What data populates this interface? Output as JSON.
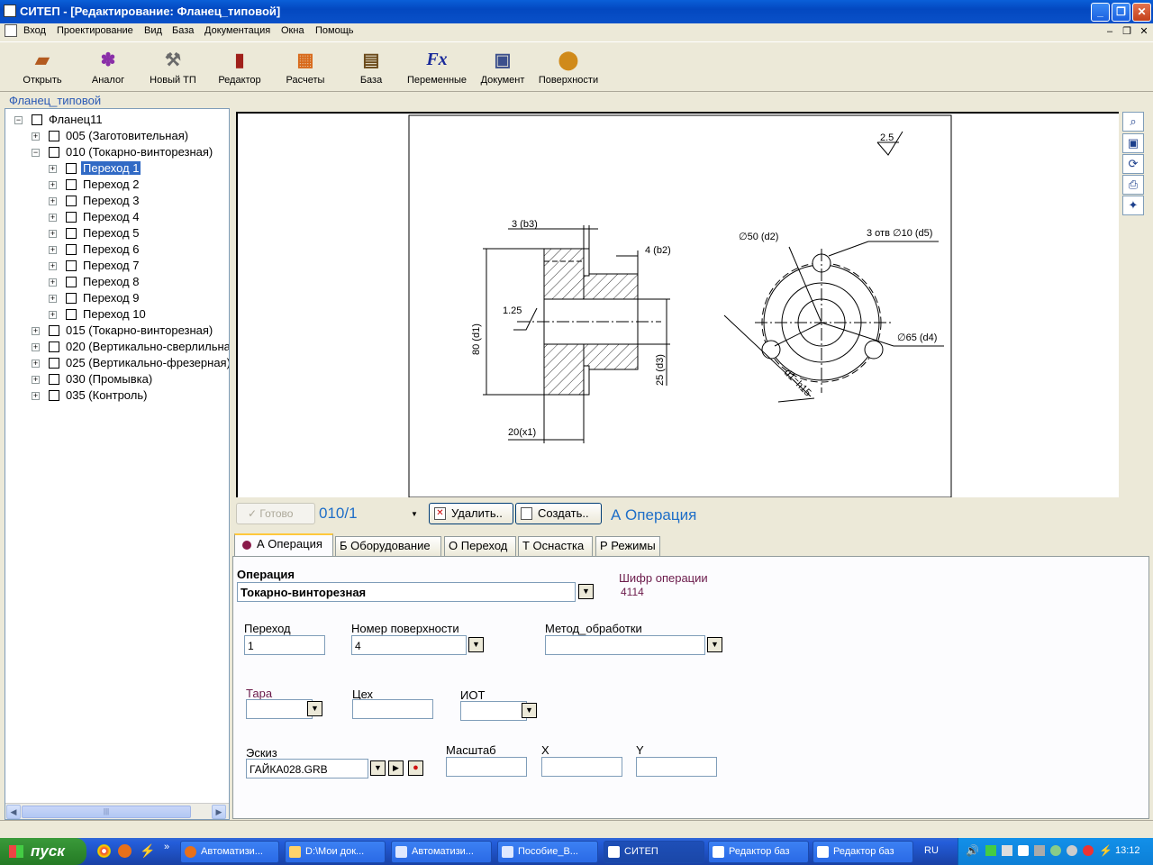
{
  "window": {
    "title": "СИТЕП - [Редактирование: Фланец_типовой]"
  },
  "menu": [
    "Вход",
    "Проектирование",
    "Вид",
    "База",
    "Документация",
    "Окна",
    "Помощь"
  ],
  "toolbar": [
    {
      "label": "Открыть",
      "icon": "open-folder-icon"
    },
    {
      "label": "Аналог",
      "icon": "analog-icon"
    },
    {
      "label": "Новый ТП",
      "icon": "new-tp-icon"
    },
    {
      "label": "Редактор",
      "icon": "editor-icon"
    },
    {
      "label": "Расчеты",
      "icon": "calculator-icon"
    },
    {
      "label": "База",
      "icon": "database-icon"
    },
    {
      "label": "Переменные",
      "icon": "fx-icon"
    },
    {
      "label": "Документ",
      "icon": "document-icon"
    },
    {
      "label": "Поверхности",
      "icon": "surfaces-icon"
    }
  ],
  "tree": {
    "title": "Фланец_типовой",
    "nodes": [
      {
        "label": "Фланец11",
        "level": 0,
        "exp": "−"
      },
      {
        "label": "005 (Заготовительная)",
        "level": 1,
        "exp": "+"
      },
      {
        "label": "010 (Токарно-винторезная)",
        "level": 1,
        "exp": "−"
      },
      {
        "label": "Переход 1",
        "level": 2,
        "exp": "+",
        "selected": true
      },
      {
        "label": "Переход 2",
        "level": 2,
        "exp": "+"
      },
      {
        "label": "Переход 3",
        "level": 2,
        "exp": "+"
      },
      {
        "label": "Переход 4",
        "level": 2,
        "exp": "+"
      },
      {
        "label": "Переход 5",
        "level": 2,
        "exp": "+"
      },
      {
        "label": "Переход 6",
        "level": 2,
        "exp": "+"
      },
      {
        "label": "Переход 7",
        "level": 2,
        "exp": "+"
      },
      {
        "label": "Переход 8",
        "level": 2,
        "exp": "+"
      },
      {
        "label": "Переход 9",
        "level": 2,
        "exp": "+"
      },
      {
        "label": "Переход 10",
        "level": 2,
        "exp": "+"
      },
      {
        "label": "015 (Токарно-винторезная)",
        "level": 1,
        "exp": "+"
      },
      {
        "label": "020 (Вертикально-сверлильная)",
        "level": 1,
        "exp": "+"
      },
      {
        "label": "025 (Вертикально-фрезерная)",
        "level": 1,
        "exp": "+"
      },
      {
        "label": "030 (Промывка)",
        "level": 1,
        "exp": "+"
      },
      {
        "label": "035 (Контроль)",
        "level": 1,
        "exp": "+"
      }
    ]
  },
  "drawing": {
    "dims": {
      "roughness": "2.5",
      "b3": "3 (b3)",
      "b2": "4 (b2)",
      "d1": "80 (d1)",
      "d3": "25 (d3)",
      "x1": "20(x1)",
      "chamfer": "1.25",
      "d2": "∅50 (d2)",
      "d5": "3 отв ∅10 (d5)",
      "d4": "∅65 (d4)",
      "d": "d1=h15"
    }
  },
  "side_icons": [
    "zoom-icon",
    "fit-view-icon",
    "refresh-icon",
    "print-icon",
    "wand-icon"
  ],
  "command": {
    "ready_label": "Готово",
    "code": "010/1",
    "delete_label": "Удалить..",
    "create_label": "Создать..",
    "section_title": "А Операция"
  },
  "tabs": [
    "А Операция",
    "Б Оборудование",
    "О Переход",
    "Т Оснастка",
    "Р Режимы"
  ],
  "form": {
    "operation_label": "Операция",
    "operation_value": "Токарно-винторезная",
    "cipher_label": "Шифр операции",
    "cipher_value": "4114",
    "transition_label": "Переход",
    "transition_value": "1",
    "surface_label": "Номер поверхности",
    "surface_value": "4",
    "method_label": "Метод_обработки",
    "method_value": "",
    "tara_label": "Тара",
    "tara_value": "",
    "shop_label": "Цех",
    "shop_value": "",
    "iot_label": "ИОТ",
    "iot_value": "",
    "sketch_label": "Эскиз",
    "sketch_value": "ГАЙКА028.GRB",
    "scale_label": "Масштаб",
    "scale_value": "",
    "x_label": "X",
    "x_value": "",
    "y_label": "Y",
    "y_value": ""
  },
  "taskbar": {
    "start": "пуск",
    "tasks": [
      "Автоматизи...",
      "D:\\Мои док...",
      "Автоматизи...",
      "Пособие_В...",
      "СИТЕП",
      "Редактор баз",
      "Редактор баз"
    ],
    "lang": "RU",
    "clock": "13:12"
  }
}
